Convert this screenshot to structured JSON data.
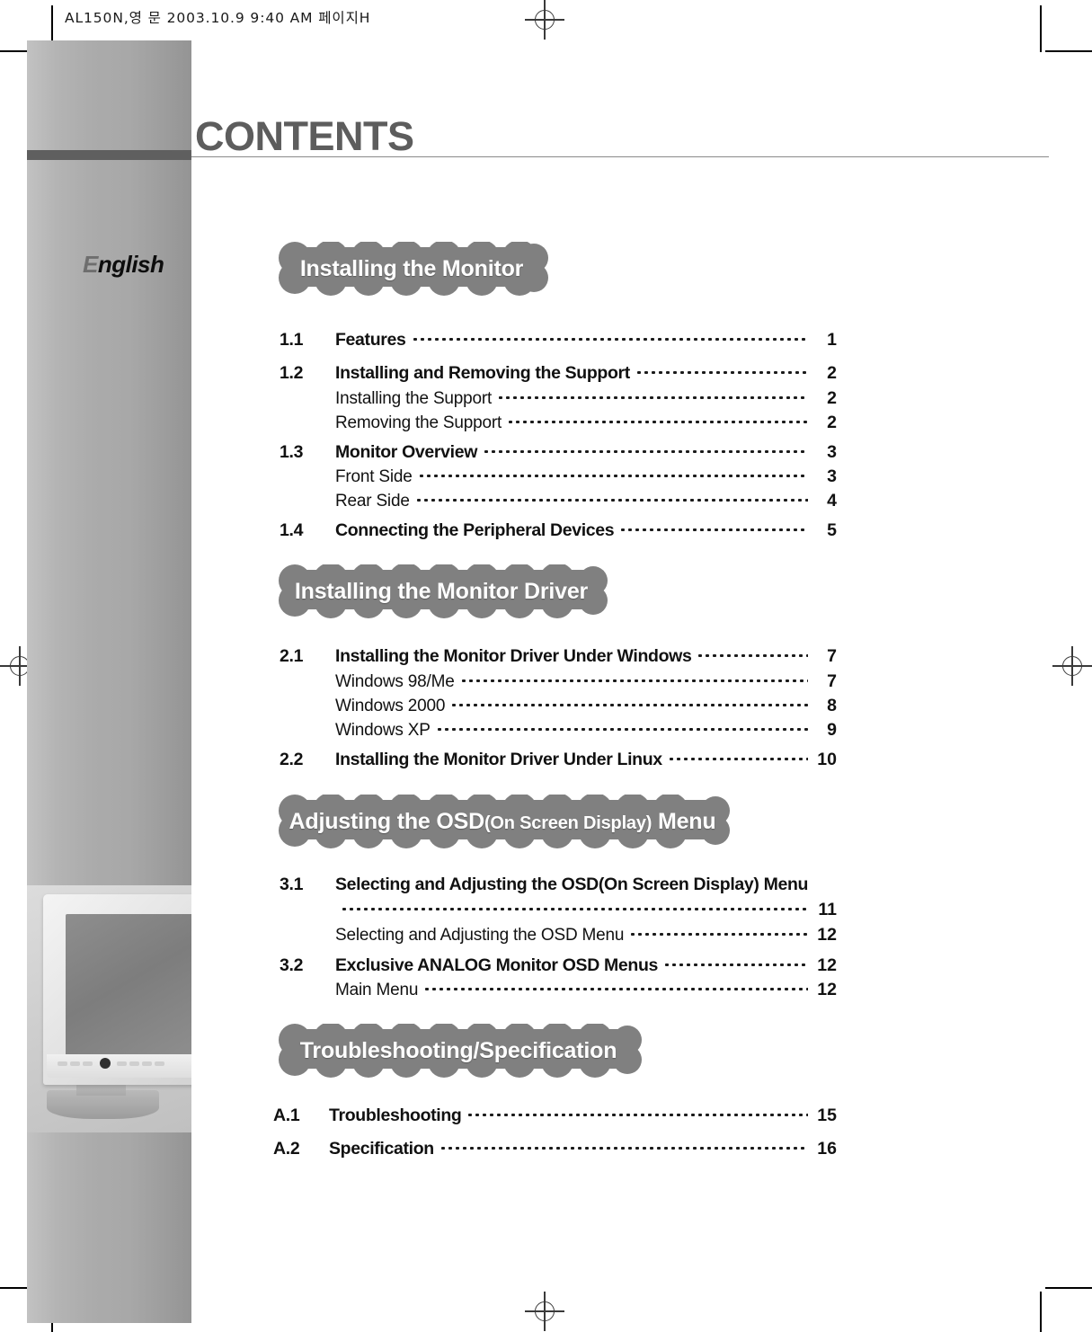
{
  "document": {
    "running_header": "AL150N,영 문  2003.10.9 9:40 AM 페이지H",
    "title": "CONTENTS",
    "language_tag_cap": "E",
    "language_tag_rest": "nglish"
  },
  "sections": [
    {
      "banner_parts": [
        {
          "text": "Installing the Monitor",
          "size": "large"
        }
      ],
      "entries": [
        {
          "num": "1.1",
          "label": "Features",
          "page": "1",
          "level": "main"
        },
        {
          "num": "1.2",
          "label": "Installing and Removing the Support",
          "page": "2",
          "level": "main"
        },
        {
          "num": "",
          "label": "Installing the Support",
          "page": "2",
          "level": "sub"
        },
        {
          "num": "",
          "label": "Removing the Support",
          "page": "2",
          "level": "sub"
        },
        {
          "num": "1.3",
          "label": "Monitor Overview",
          "page": "3",
          "level": "main"
        },
        {
          "num": "",
          "label": "Front Side",
          "page": "3",
          "level": "sub"
        },
        {
          "num": "",
          "label": "Rear Side",
          "page": "4",
          "level": "sub"
        },
        {
          "num": "1.4",
          "label": "Connecting the Peripheral Devices",
          "page": "5",
          "level": "main"
        }
      ]
    },
    {
      "banner_parts": [
        {
          "text": "Installing the Monitor Driver",
          "size": "large"
        }
      ],
      "entries": [
        {
          "num": "2.1",
          "label": "Installing the Monitor Driver Under Windows",
          "page": "7",
          "level": "main"
        },
        {
          "num": "",
          "label": "Windows 98/Me",
          "page": "7",
          "level": "sub"
        },
        {
          "num": "",
          "label": "Windows 2000",
          "page": "8",
          "level": "sub"
        },
        {
          "num": "",
          "label": "Windows XP",
          "page": "9",
          "level": "sub"
        },
        {
          "num": "2.2",
          "label": "Installing the Monitor Driver Under Linux",
          "page": "10",
          "level": "main"
        }
      ]
    },
    {
      "banner_parts": [
        {
          "text": "Adjusting the OSD",
          "size": "large"
        },
        {
          "text": "(On Screen Display)",
          "size": "small"
        },
        {
          "text": " Menu",
          "size": "large"
        }
      ],
      "entries": [
        {
          "num": "3.1",
          "label": "Selecting and Adjusting the OSD(On Screen Display) Menu",
          "page": "11",
          "level": "main-wrap"
        },
        {
          "num": "",
          "label": "Selecting and Adjusting the OSD Menu",
          "page": "12",
          "level": "sub"
        },
        {
          "num": "3.2",
          "label": "Exclusive ANALOG Monitor OSD Menus",
          "page": "12",
          "level": "main"
        },
        {
          "num": "",
          "label": "Main Menu",
          "page": "12",
          "level": "sub"
        }
      ]
    },
    {
      "banner_parts": [
        {
          "text": "Troubleshooting/Specification",
          "size": "large"
        }
      ],
      "entries": [
        {
          "num": "A.1",
          "label": "Troubleshooting",
          "page": "15",
          "level": "main"
        },
        {
          "num": "A.2",
          "label": "Specification",
          "page": "16",
          "level": "main"
        }
      ]
    }
  ],
  "colors": {
    "banner_fill": "#808080",
    "title_gray": "#5d5d5d",
    "sidebar_dark_bar": "#5f5f5f",
    "text": "#111111"
  }
}
